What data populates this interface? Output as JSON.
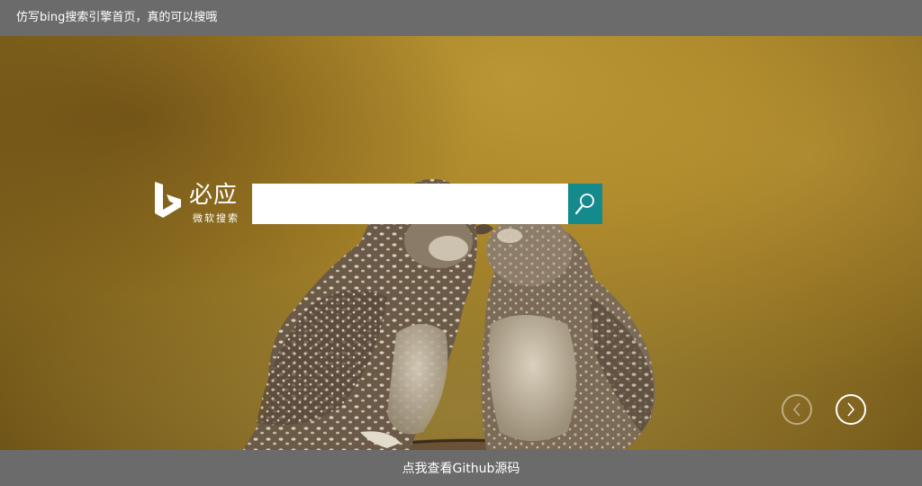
{
  "header": {
    "title": "仿写bing搜索引擎首页，真的可以搜哦"
  },
  "logo": {
    "brand": "必应",
    "subtitle": "微软搜索",
    "icon": "bing-b-icon"
  },
  "search": {
    "value": "",
    "placeholder": "",
    "button_icon": "search-icon",
    "button_color": "#158a8c"
  },
  "carousel": {
    "prev_icon": "chevron-left-icon",
    "next_icon": "chevron-right-icon"
  },
  "footer": {
    "link_text": "点我查看Github源码"
  },
  "colors": {
    "bar_background": "#6b6b6b",
    "accent": "#158a8c"
  }
}
